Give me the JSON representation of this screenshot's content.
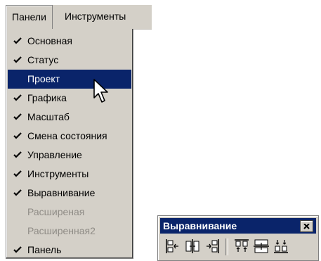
{
  "menubar": {
    "items": [
      {
        "label": "Панели"
      },
      {
        "label": "Инструменты"
      }
    ]
  },
  "menu": {
    "items": [
      {
        "label": "Основная",
        "checked": true,
        "state": "normal"
      },
      {
        "label": "Статус",
        "checked": true,
        "state": "normal"
      },
      {
        "label": "Проект",
        "checked": false,
        "state": "selected"
      },
      {
        "label": "Графика",
        "checked": true,
        "state": "normal"
      },
      {
        "label": "Масштаб",
        "checked": true,
        "state": "normal"
      },
      {
        "label": "Смена состояния",
        "checked": true,
        "state": "normal"
      },
      {
        "label": "Управление",
        "checked": true,
        "state": "normal"
      },
      {
        "label": "Инструменты",
        "checked": true,
        "state": "normal"
      },
      {
        "label": "Выравнивание",
        "checked": true,
        "state": "normal"
      },
      {
        "label": "Расширеная",
        "checked": false,
        "state": "disabled"
      },
      {
        "label": "Расширенная2",
        "checked": false,
        "state": "disabled"
      },
      {
        "label": "Панель",
        "checked": true,
        "state": "normal"
      }
    ]
  },
  "toolbar": {
    "title": "Выравнивание",
    "close_icon": "close-icon",
    "buttons": [
      {
        "icon": "align-left-icon"
      },
      {
        "icon": "align-center-horizontal-icon"
      },
      {
        "icon": "align-right-icon"
      },
      {
        "icon": "align-top-icon"
      },
      {
        "icon": "align-center-vertical-icon"
      },
      {
        "icon": "align-bottom-icon"
      }
    ]
  },
  "colors": {
    "face": "#d4d0c8",
    "selection": "#0a246a",
    "disabled_text": "#8f8c86"
  }
}
